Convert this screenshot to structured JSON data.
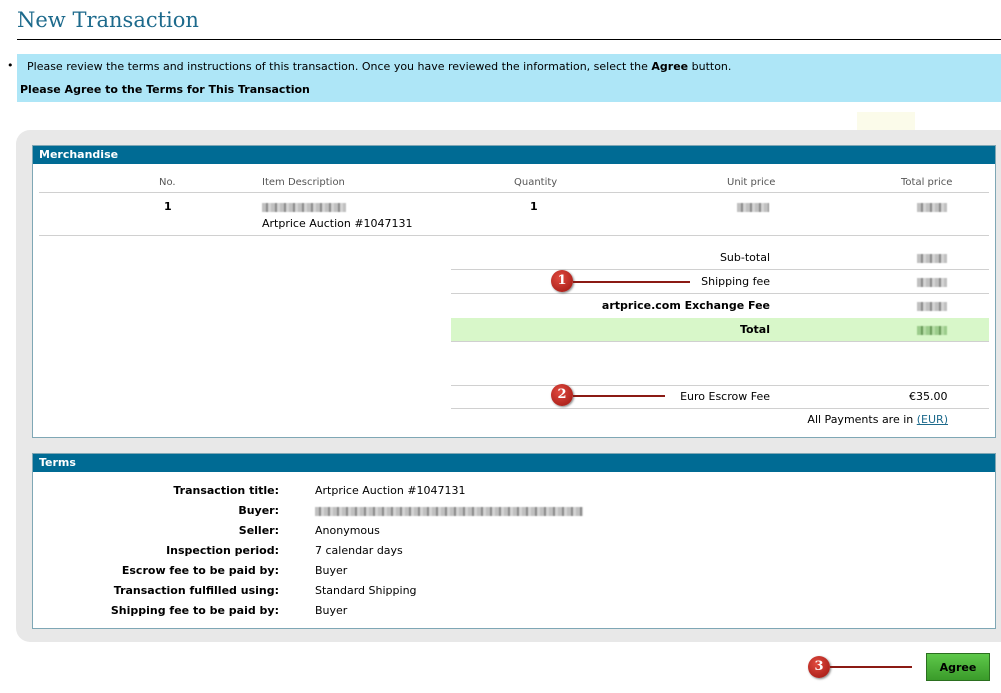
{
  "page": {
    "title": "New Transaction",
    "notice_text_1": "Please review the terms and instructions of this transaction. Once you have reviewed the information, select the ",
    "notice_text_bold": "Agree",
    "notice_text_2": " button.",
    "notice_line2": "Please Agree to the Terms for This Transaction"
  },
  "merchandise": {
    "heading": "Merchandise",
    "columns": [
      "No.",
      "Item Description",
      "Quantity",
      "Unit price",
      "Total price"
    ],
    "item": {
      "no": "1",
      "description_sub": "Artprice Auction #1047131",
      "quantity": "1"
    },
    "summary": {
      "subtotal_label": "Sub-total",
      "shipping_label": "Shipping fee",
      "exchange_label": "artprice.com Exchange Fee",
      "total_label": "Total",
      "escrow_label": "Euro Escrow Fee",
      "escrow_value": "€35.00",
      "payments_text": "All Payments are in ",
      "currency_link": "(EUR)"
    }
  },
  "terms": {
    "heading": "Terms",
    "rows": [
      {
        "label": "Transaction title:",
        "value": "Artprice Auction #1047131"
      },
      {
        "label": "Buyer:",
        "value": ""
      },
      {
        "label": "Seller:",
        "value": "Anonymous"
      },
      {
        "label": "Inspection period:",
        "value": "7 calendar days"
      },
      {
        "label": "Escrow fee to be paid by:",
        "value": "Buyer"
      },
      {
        "label": "Transaction fulfilled using:",
        "value": "Standard Shipping"
      },
      {
        "label": "Shipping fee to be paid by:",
        "value": "Buyer"
      }
    ]
  },
  "markers": {
    "one": "1",
    "two": "2",
    "three": "3"
  },
  "actions": {
    "agree_label": "Agree"
  },
  "colors": {
    "heading_bar": "#006b94",
    "notice_bg": "#aee6f7",
    "total_row": "#d8f7c9",
    "agree_button": "#4cb83a",
    "marker": "#b8231b"
  }
}
